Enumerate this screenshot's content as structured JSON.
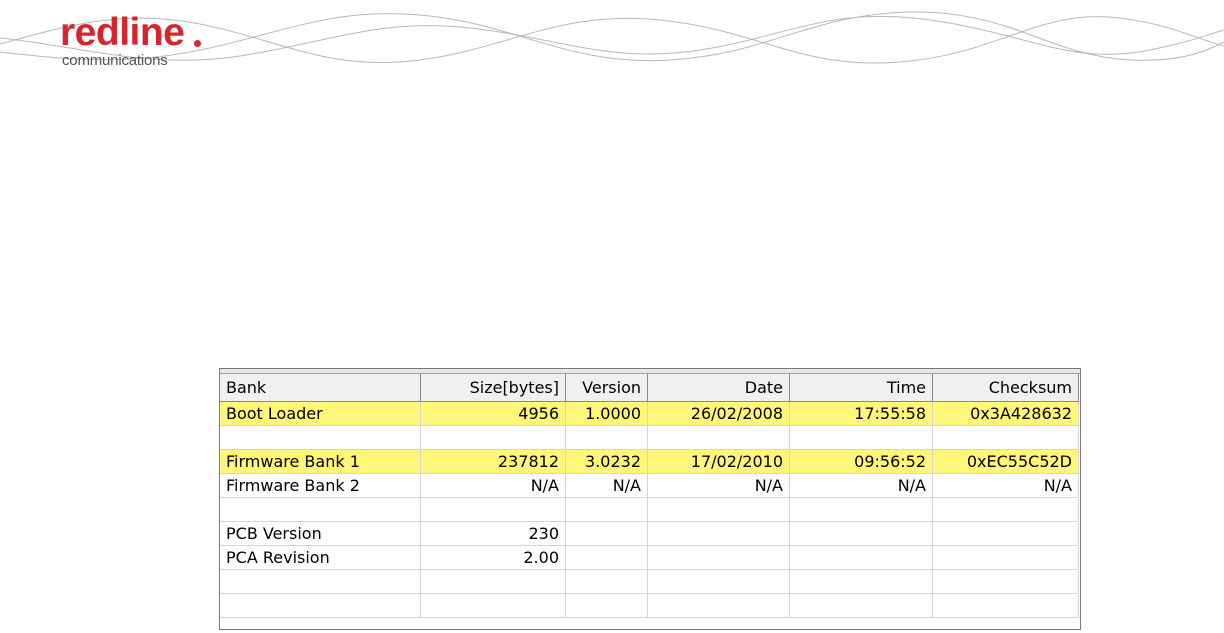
{
  "logo": {
    "word": "redline",
    "tagline": "communications"
  },
  "colors": {
    "brand_red": "#d6262b",
    "highlight_row": "#fff67a",
    "header_bg": "#f0f0f0",
    "grid_line": "#d4d4d4"
  },
  "table": {
    "columns": [
      "Bank",
      "Size[bytes]",
      "Version",
      "Date",
      "Time",
      "Checksum"
    ],
    "rows": [
      {
        "highlight": true,
        "cells": [
          "Boot Loader",
          "4956",
          "1.0000",
          "26/02/2008",
          "17:55:58",
          "0x3A428632"
        ]
      },
      {
        "highlight": false,
        "cells": [
          "",
          "",
          "",
          "",
          "",
          ""
        ]
      },
      {
        "highlight": true,
        "cells": [
          "Firmware Bank 1",
          "237812",
          "3.0232",
          "17/02/2010",
          "09:56:52",
          "0xEC55C52D"
        ]
      },
      {
        "highlight": false,
        "cells": [
          "Firmware Bank 2",
          "N/A",
          "N/A",
          "N/A",
          "N/A",
          "N/A"
        ]
      },
      {
        "highlight": false,
        "cells": [
          "",
          "",
          "",
          "",
          "",
          ""
        ]
      },
      {
        "highlight": false,
        "cells": [
          "PCB Version",
          "230",
          "",
          "",
          "",
          ""
        ]
      },
      {
        "highlight": false,
        "cells": [
          "PCA Revision",
          "2.00",
          "",
          "",
          "",
          ""
        ]
      },
      {
        "highlight": false,
        "cells": [
          "",
          "",
          "",
          "",
          "",
          ""
        ]
      },
      {
        "highlight": false,
        "cells": [
          "",
          "",
          "",
          "",
          "",
          ""
        ]
      }
    ]
  }
}
